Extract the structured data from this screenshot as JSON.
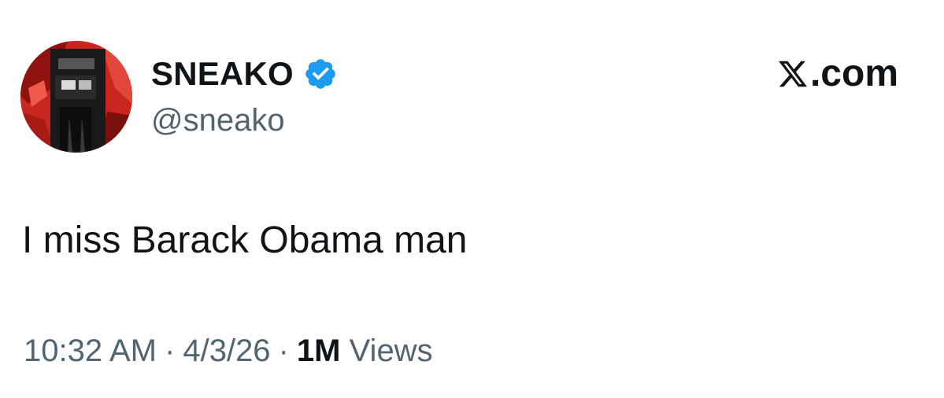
{
  "author": {
    "display_name": "SNEAKO",
    "handle": "@sneako",
    "verified": true,
    "avatar_icon": "profile-photo"
  },
  "brand": {
    "logo_icon": "x-logo-icon",
    "text": ".com"
  },
  "tweet": {
    "text": "I miss Barack Obama man"
  },
  "meta": {
    "time": "10:32 AM",
    "separator": "·",
    "date": "4/3/26",
    "views_count": "1M",
    "views_label": "Views"
  },
  "colors": {
    "text_primary": "#0f1419",
    "text_secondary": "#536471",
    "verified_badge": "#1d9bf0",
    "background": "#ffffff"
  }
}
